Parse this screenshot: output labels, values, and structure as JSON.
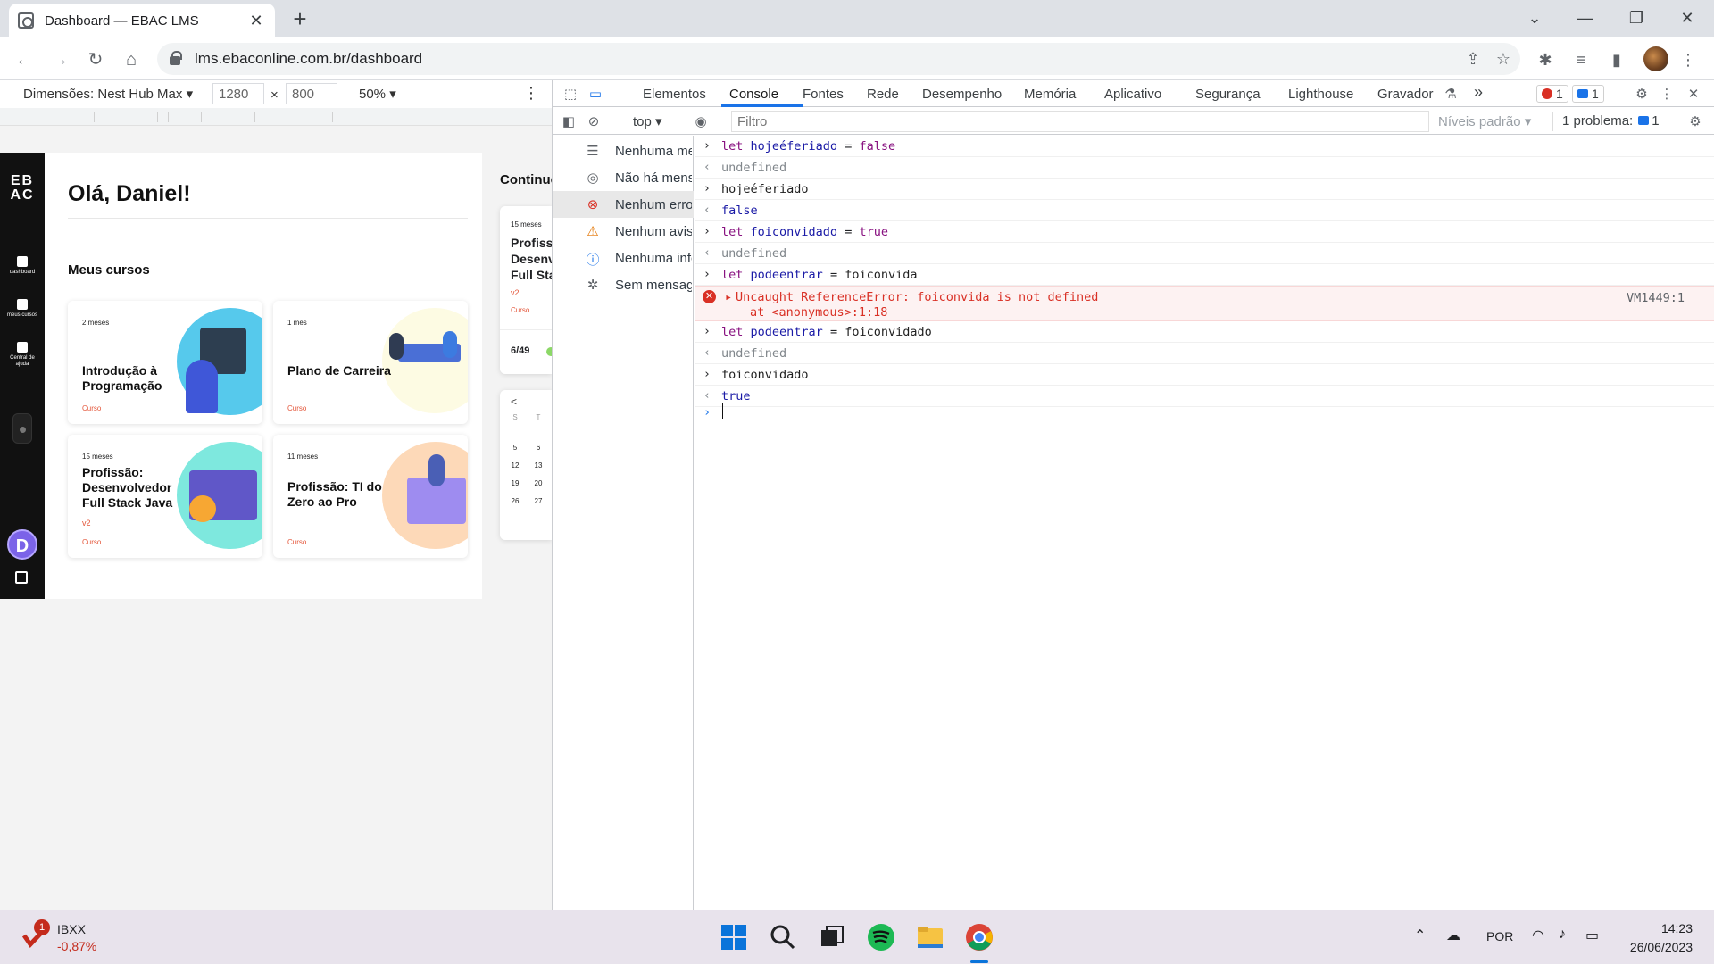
{
  "browser": {
    "tab_title": "Dashboard — EBAC LMS",
    "url": "lms.ebaconline.com.br/dashboard"
  },
  "device_toolbar": {
    "dimensions_label": "Dimensões: Nest Hub Max",
    "width": "1280",
    "height": "800",
    "zoom": "50%"
  },
  "page": {
    "logo": "EB AC",
    "sidebar": [
      {
        "label": "dashboard"
      },
      {
        "label": "meus cursos"
      },
      {
        "label": "Central de ajuda"
      }
    ],
    "avatar_letter": "D",
    "greeting": "Olá, Daniel!",
    "my_courses_heading": "Meus cursos",
    "courses": [
      {
        "duration": "2 meses",
        "title": "Introdução à Programação",
        "version": "",
        "kind": "Curso"
      },
      {
        "duration": "1 mês",
        "title": "Plano de Carreira",
        "version": "",
        "kind": "Curso"
      },
      {
        "duration": "15 meses",
        "title": "Profissão: Desenvolvedor Full Stack Java",
        "version": "v2",
        "kind": "Curso"
      },
      {
        "duration": "11 meses",
        "title": "Profissão: TI do Zero ao Pro",
        "version": "",
        "kind": "Curso"
      }
    ],
    "continue": {
      "heading": "Continue",
      "duration": "15 meses",
      "title": "Profissão: Desenvolvedor Full Stack",
      "version": "v2",
      "kind": "Curso",
      "progress": "6/49"
    },
    "calendar": {
      "prev": "<",
      "day_headers": [
        "S",
        "T"
      ],
      "rows": [
        [
          "5",
          "6"
        ],
        [
          "12",
          "13"
        ],
        [
          "19",
          "20"
        ],
        [
          "26",
          "27"
        ]
      ]
    }
  },
  "devtools": {
    "tabs": [
      "Elementos",
      "Console",
      "Fontes",
      "Rede",
      "Desempenho",
      "Memória",
      "Aplicativo",
      "Segurança",
      "Lighthouse",
      "Gravador"
    ],
    "active_tab": "Console",
    "more_tabs": "»",
    "error_count": "1",
    "message_count": "1",
    "context": "top",
    "filter_placeholder": "Filtro",
    "levels": "Níveis padrão",
    "problems": "1 problema:",
    "problems_count": "1",
    "sidebar": [
      {
        "label": "Nenhuma mensagem",
        "icon": "list-icon"
      },
      {
        "label": "Não há mensagens do usuário",
        "icon": "user-icon"
      },
      {
        "label": "Nenhum erro",
        "icon": "error-icon"
      },
      {
        "label": "Nenhum aviso",
        "icon": "warning-icon"
      },
      {
        "label": "Nenhuma informação",
        "icon": "info-icon"
      },
      {
        "label": "Sem mensagens detalhadas",
        "icon": "bug-icon"
      }
    ],
    "console_lines": [
      {
        "type": "input",
        "text": "let hojeéferiado = false"
      },
      {
        "type": "output",
        "text": "undefined"
      },
      {
        "type": "input",
        "text": "hojeéferiado"
      },
      {
        "type": "output",
        "text": "false"
      },
      {
        "type": "input",
        "text": "let foiconvidado = true"
      },
      {
        "type": "output",
        "text": "undefined"
      },
      {
        "type": "input",
        "text": "let podeentrar = foiconvida"
      },
      {
        "type": "error",
        "text": "Uncaught ReferenceError: foiconvida is not defined",
        "text2": "at <anonymous>:1:18",
        "source": "VM1449:1"
      },
      {
        "type": "input",
        "text": "let podeentrar = foiconvidado"
      },
      {
        "type": "output",
        "text": "undefined"
      },
      {
        "type": "input",
        "text": "foiconvidado"
      },
      {
        "type": "output",
        "text": "true"
      }
    ]
  },
  "taskbar": {
    "stock_name": "IBXX",
    "stock_change": "-0,87%",
    "stock_badge": "1",
    "language": "POR",
    "time": "14:23",
    "date": "26/06/2023"
  },
  "colors": {
    "accent": "#1a73e8",
    "error": "#d93025",
    "course_kind": "#e4573b",
    "sidebar_bg": "#111111",
    "avatar": "#7b63e8"
  }
}
